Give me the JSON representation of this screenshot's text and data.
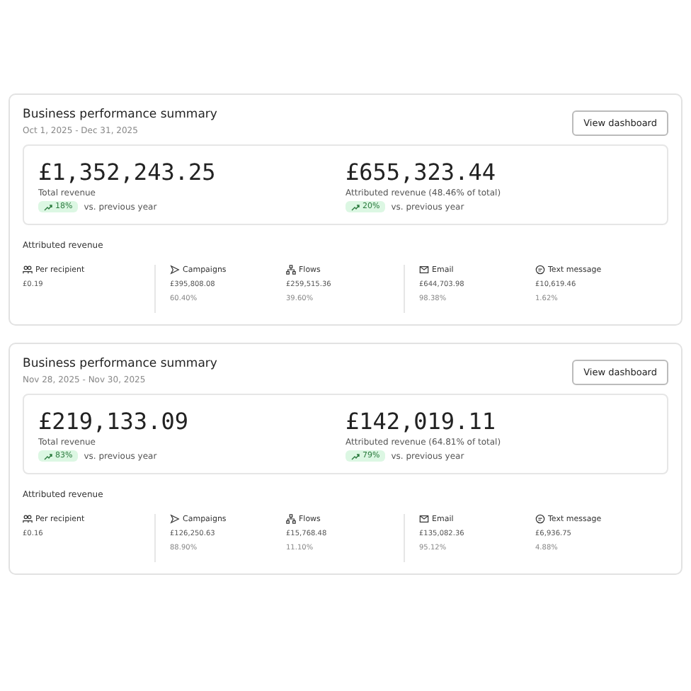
{
  "summaries": [
    {
      "title": "Business performance summary",
      "date_range": "Oct 1, 2025 - Dec 31, 2025",
      "button": "View dashboard",
      "totals": [
        {
          "value": "£1,352,243.25",
          "label": "Total revenue",
          "change": "18%",
          "up": true,
          "comparison": "vs. previous year"
        },
        {
          "value": "£655,323.44",
          "label": "Attributed revenue (48.46% of total)",
          "change": "20%",
          "up": true,
          "comparison": "vs. previous year"
        }
      ],
      "section_title": "Attributed revenue",
      "groups": [
        [
          {
            "kind": "recipient",
            "label": "Per recipient",
            "value": "£0.19"
          }
        ],
        [
          {
            "kind": "campaigns",
            "label": "Campaigns",
            "value": "£395,808.08",
            "share": "60.40%"
          },
          {
            "kind": "flows",
            "label": "Flows",
            "value": "£259,515.36",
            "share": "39.60%"
          }
        ],
        [
          {
            "kind": "email",
            "label": "Email",
            "value": "£644,703.98",
            "share": "98.38%"
          },
          {
            "kind": "sms",
            "label": "Text message",
            "value": "£10,619.46",
            "share": "1.62%"
          }
        ]
      ]
    },
    {
      "title": "Business performance summary",
      "date_range": "Nov 28, 2025 - Nov 30, 2025",
      "button": "View dashboard",
      "totals": [
        {
          "value": "£219,133.09",
          "label": "Total revenue",
          "change": "83%",
          "up": true,
          "comparison": "vs. previous year"
        },
        {
          "value": "£142,019.11",
          "label": "Attributed revenue (64.81% of total)",
          "change": "79%",
          "up": true,
          "comparison": "vs. previous year"
        }
      ],
      "section_title": "Attributed revenue",
      "groups": [
        [
          {
            "kind": "recipient",
            "label": "Per recipient",
            "value": "£0.16"
          }
        ],
        [
          {
            "kind": "campaigns",
            "label": "Campaigns",
            "value": "£126,250.63",
            "share": "88.90%"
          },
          {
            "kind": "flows",
            "label": "Flows",
            "value": "£15,768.48",
            "share": "11.10%"
          }
        ],
        [
          {
            "kind": "email",
            "label": "Email",
            "value": "£135,082.36",
            "share": "95.12%"
          },
          {
            "kind": "sms",
            "label": "Text message",
            "value": "£6,936.75",
            "share": "4.88%"
          }
        ]
      ]
    }
  ]
}
